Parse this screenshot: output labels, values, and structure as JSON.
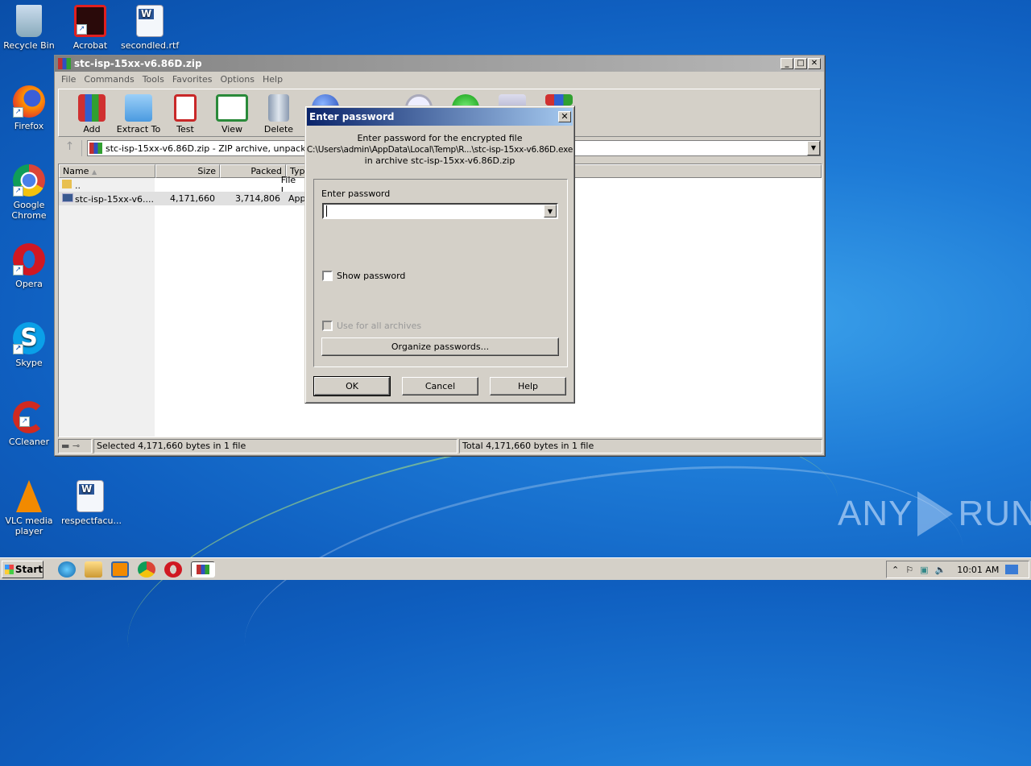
{
  "desktop": {
    "icons": [
      {
        "label": "Recycle Bin",
        "icon": "recycle-bin-icon"
      },
      {
        "label": "Acrobat",
        "icon": "acrobat-icon"
      },
      {
        "label": "secondled.rtf",
        "icon": "word-doc-icon"
      },
      {
        "label": "Firefox",
        "icon": "firefox-icon"
      },
      {
        "label": "Google Chrome",
        "icon": "chrome-icon"
      },
      {
        "label": "Opera",
        "icon": "opera-icon"
      },
      {
        "label": "Skype",
        "icon": "skype-icon"
      },
      {
        "label": "CCleaner",
        "icon": "ccleaner-icon"
      },
      {
        "label": "VLC media player",
        "icon": "vlc-icon"
      },
      {
        "label": "respectfacu...",
        "icon": "word-doc-icon"
      }
    ]
  },
  "window": {
    "title": "stc-isp-15xx-v6.86D.zip",
    "menu": [
      "File",
      "Commands",
      "Tools",
      "Favorites",
      "Options",
      "Help"
    ],
    "toolbar": [
      "Add",
      "Extract To",
      "Test",
      "View",
      "Delete"
    ],
    "address": "stc-isp-15xx-v6.86D.zip - ZIP archive, unpacked",
    "columns": [
      "Name",
      "Size",
      "Packed",
      "Type"
    ],
    "rows": [
      {
        "name": "..",
        "size": "",
        "packed": "",
        "type": "File I"
      },
      {
        "name": "stc-isp-15xx-v6....",
        "size": "4,171,660",
        "packed": "3,714,806",
        "type": "Appl"
      }
    ],
    "status_left": "Selected 4,171,660 bytes in 1 file",
    "status_right": "Total 4,171,660 bytes in 1 file"
  },
  "dialog": {
    "title": "Enter password",
    "msg1": "Enter password for the encrypted file",
    "msg2": "C:\\Users\\admin\\AppData\\Local\\Temp\\R...\\stc-isp-15xx-v6.86D.exe",
    "msg3": "in archive stc-isp-15xx-v6.86D.zip",
    "field_label": "Enter password",
    "password_value": "",
    "show_password": "Show password",
    "use_all": "Use for all archives",
    "organize": "Organize passwords...",
    "ok": "OK",
    "cancel": "Cancel",
    "help": "Help"
  },
  "taskbar": {
    "start": "Start",
    "clock": "10:01 AM"
  },
  "watermark": {
    "left": "ANY",
    "right": "RUN"
  }
}
